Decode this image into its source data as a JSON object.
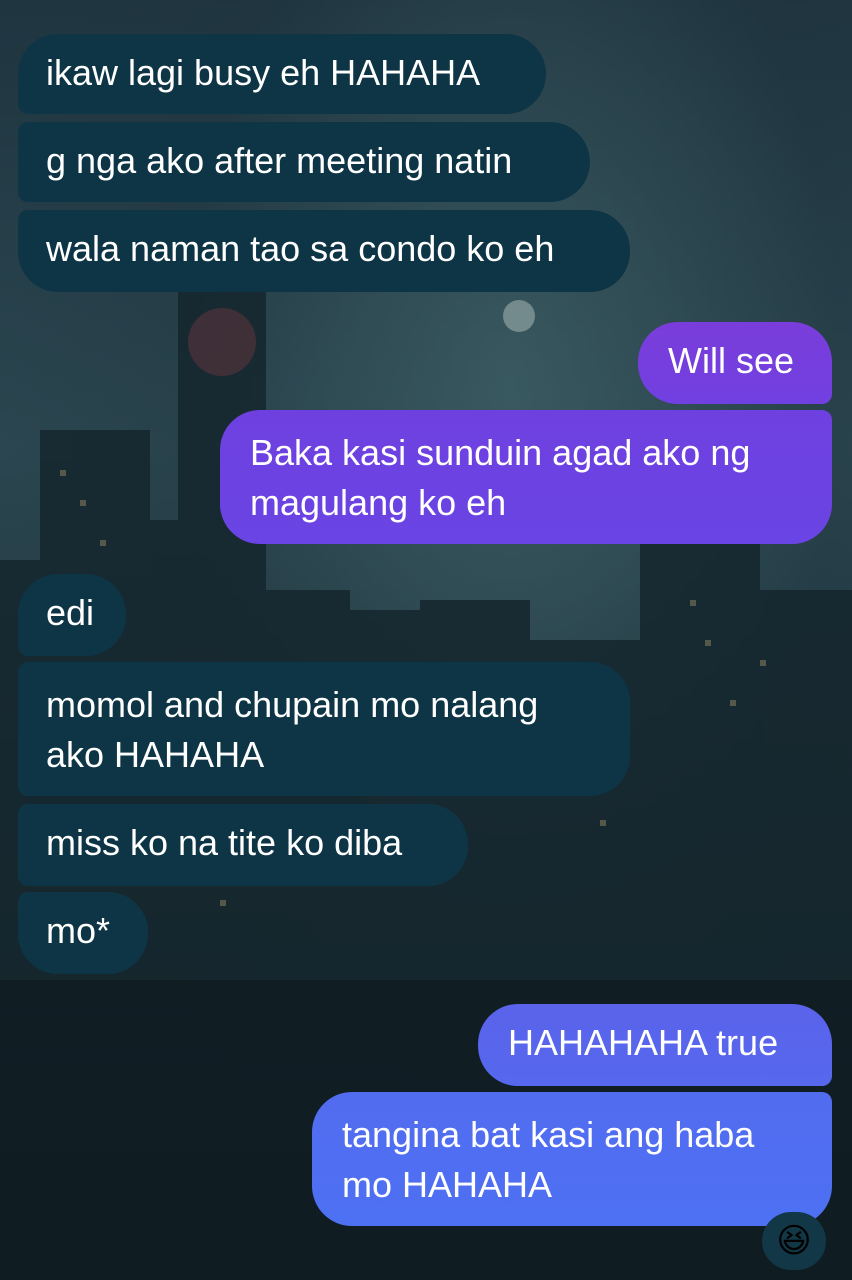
{
  "conversation": {
    "messages": [
      {
        "direction": "received",
        "text": "ikaw lagi busy eh HAHAHA"
      },
      {
        "direction": "received",
        "text": "g nga ako after meeting natin"
      },
      {
        "direction": "received",
        "text": "wala naman tao sa condo ko eh"
      },
      {
        "direction": "sent",
        "text": "Will see"
      },
      {
        "direction": "sent",
        "lines": [
          "Baka kasi sunduin agad ako ng",
          "magulang ko eh"
        ]
      },
      {
        "direction": "received",
        "text": "edi"
      },
      {
        "direction": "received",
        "lines": [
          "momol and chupain mo nalang",
          "ako HAHAHA"
        ]
      },
      {
        "direction": "received",
        "text": "miss ko na tite ko diba"
      },
      {
        "direction": "received",
        "text": "mo*"
      },
      {
        "direction": "sent",
        "text": "HAHAHAHA true"
      },
      {
        "direction": "sent",
        "lines": [
          "tangina bat kasi ang haba",
          "mo HAHAHA"
        ]
      }
    ],
    "reaction": {
      "icon": "laughing-face-emoji",
      "emoji": "😆"
    }
  },
  "colors": {
    "received_bubble": "#0e3546",
    "sent_gradient_top": "#7b3ddb",
    "sent_gradient_bottom": "#4f6ff0"
  }
}
